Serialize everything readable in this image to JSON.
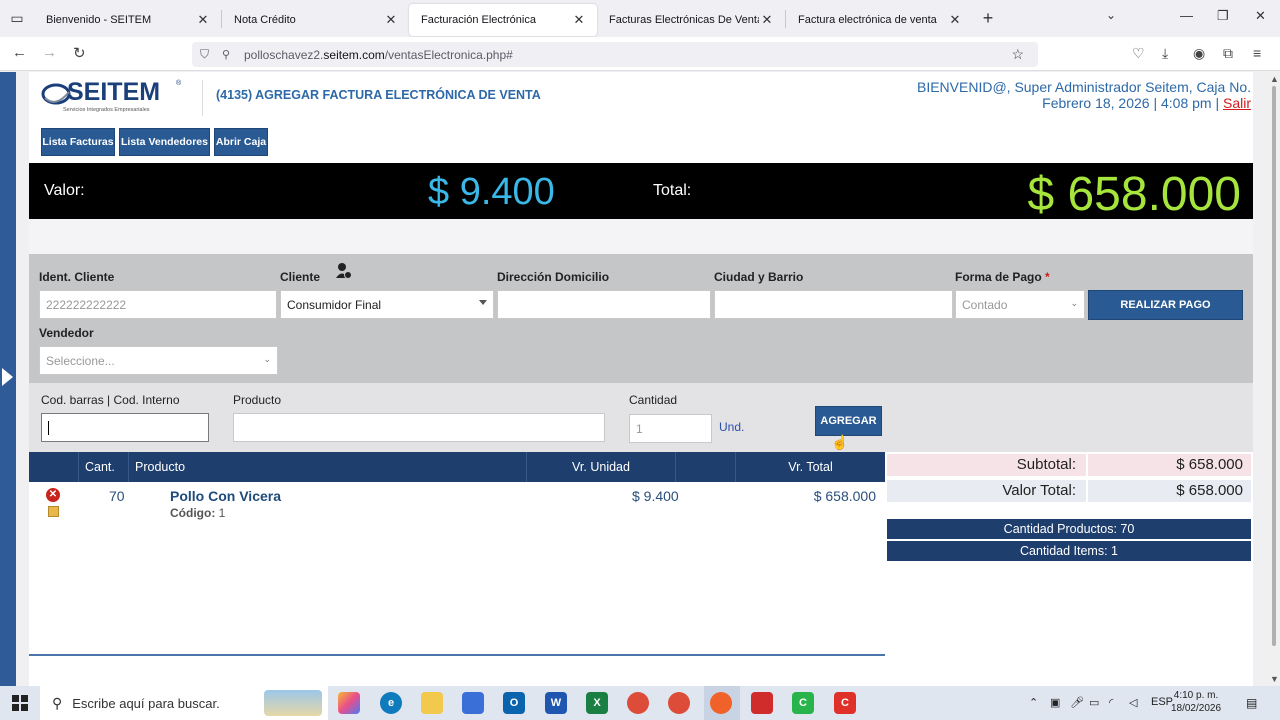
{
  "browser": {
    "tabs": [
      {
        "label": "Bienvenido - SEITEM",
        "active": false
      },
      {
        "label": "Nota Crédito",
        "active": false
      },
      {
        "label": "Facturación Electrónica",
        "active": true
      },
      {
        "label": "Facturas Electrónicas De Ventas",
        "active": false
      },
      {
        "label": "Factura electrónica de venta",
        "active": false
      }
    ],
    "url_prefix": "polloschavez2.",
    "url_domain": "seitem.com",
    "url_path": "/ventasElectronica.php#"
  },
  "header": {
    "logo_text": "SEITEM",
    "logo_subtitle": "Servicios Integrados Empresariales",
    "page_title": "(4135) AGREGAR FACTURA ELECTRÓNICA DE VENTA",
    "welcome": "BIENVENID@, Super Administrador Seitem, Caja No.",
    "date": "Febrero 18, 2026 | 4:08 pm |",
    "logout": "Salir"
  },
  "toolbar": {
    "list_invoices": "Lista Facturas",
    "list_sellers": "Lista Vendedores",
    "open_cash": "Abrir Caja"
  },
  "banner": {
    "value_label": "Valor:",
    "value": "$ 9.400",
    "total_label": "Total:",
    "total": "$ 658.000"
  },
  "form": {
    "client_id_label": "Ident. Cliente",
    "client_id_placeholder": "222222222222",
    "client_label": "Cliente",
    "client_value": "Consumidor Final",
    "address_label": "Dirección Domicilio",
    "city_label": "Ciudad y Barrio",
    "payment_label": "Forma de Pago",
    "payment_required": "*",
    "payment_value": "Contado",
    "pay_button": "REALIZAR PAGO",
    "seller_label": "Vendedor",
    "seller_placeholder": "Seleccione..."
  },
  "product_entry": {
    "barcode_label": "Cod. barras | Cod. Interno",
    "product_label": "Producto",
    "quantity_label": "Cantidad",
    "quantity_value": "1",
    "unit": "Und.",
    "add_button": "AGREGAR"
  },
  "table": {
    "headers": {
      "qty": "Cant.",
      "product": "Producto",
      "unit_price": "Vr. Unidad",
      "total": "Vr. Total"
    },
    "rows": [
      {
        "qty": "70",
        "product": "Pollo Con Vicera",
        "code_label": "Código:",
        "code": "1",
        "unit_price": "$ 9.400",
        "total": "$ 658.000"
      }
    ]
  },
  "summary": {
    "subtotal_label": "Subtotal:",
    "subtotal": "$ 658.000",
    "total_label": "Valor Total:",
    "total": "$ 658.000",
    "product_count": "Cantidad Productos: 70",
    "item_count": "Cantidad Items: 1"
  },
  "taskbar": {
    "search_placeholder": "Escribe aquí para buscar.",
    "language": "ESP",
    "time": "4:10 p. m.",
    "date": "18/02/2026"
  }
}
